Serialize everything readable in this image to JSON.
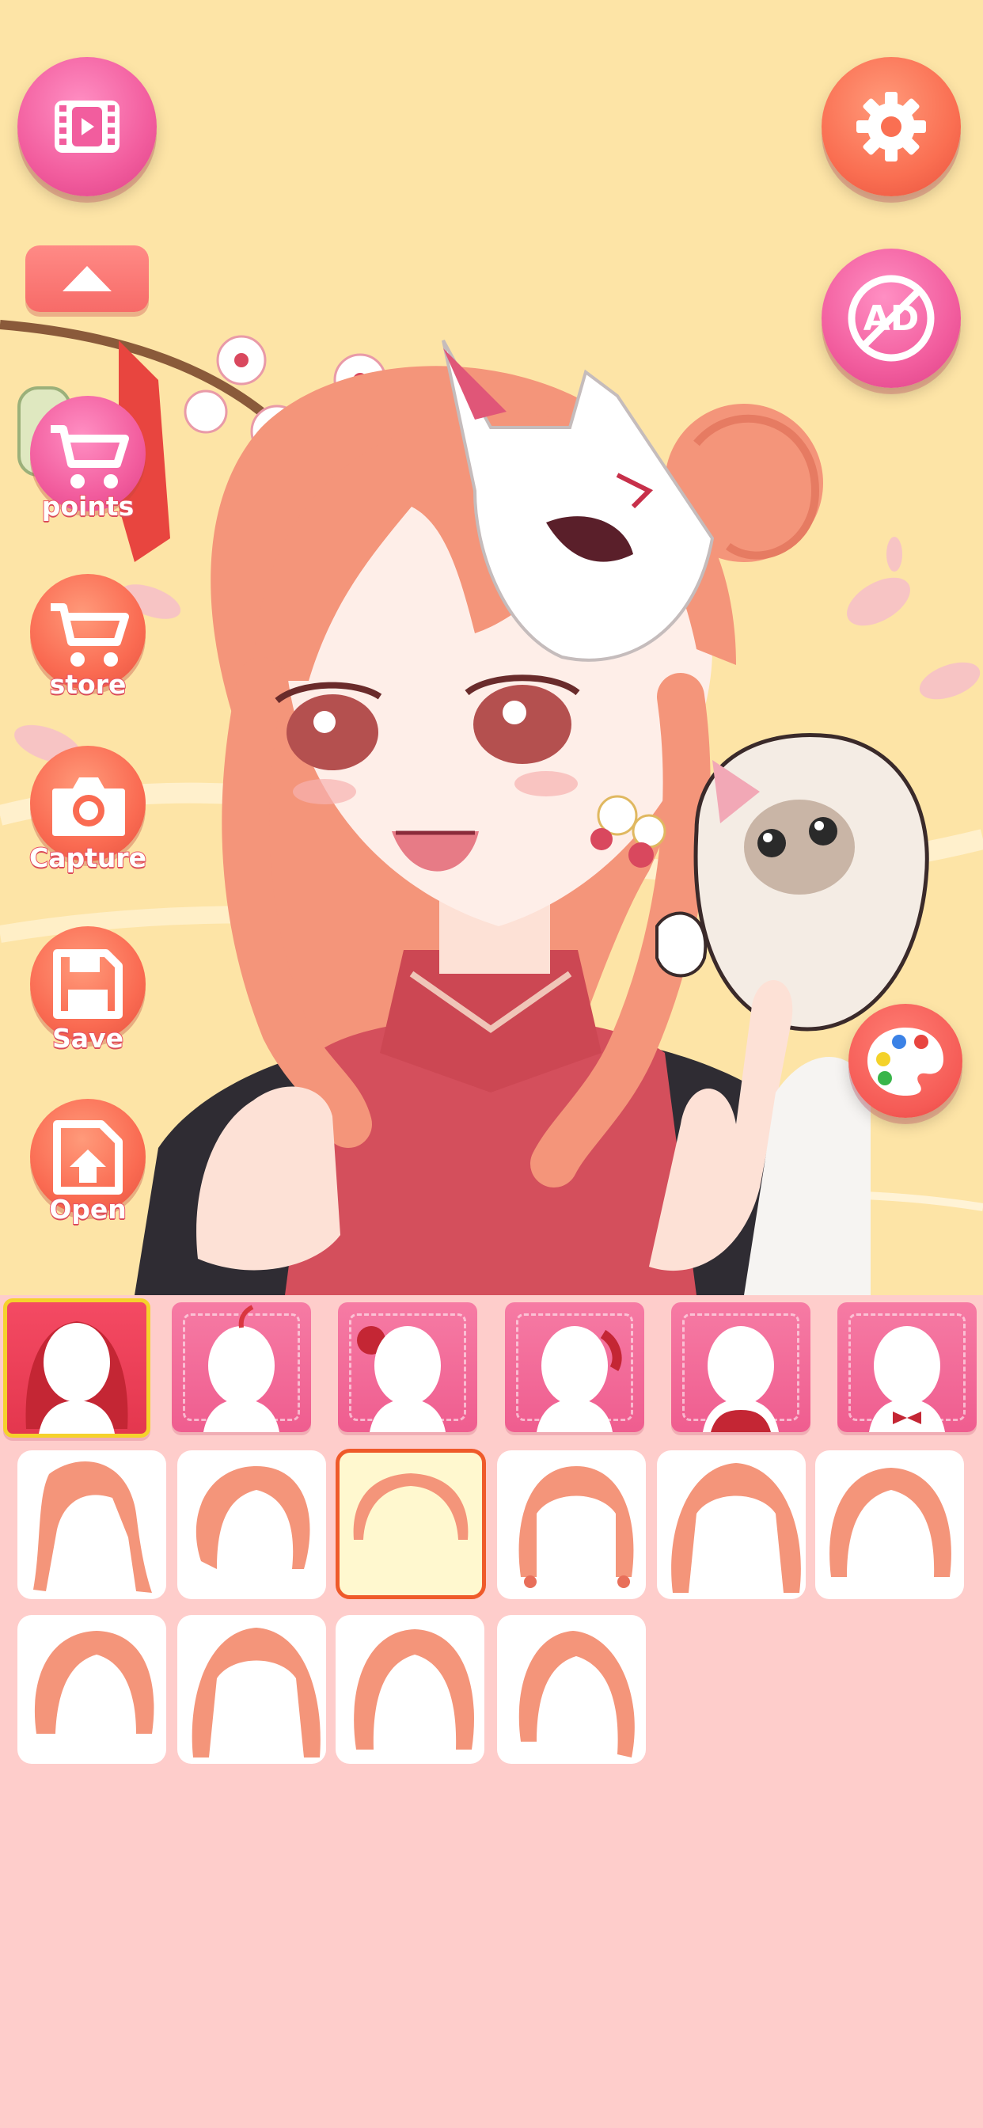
{
  "sidebar": {
    "points_label": "points",
    "store_label": "store",
    "capture_label": "Capture",
    "save_label": "Save",
    "open_label": "Open"
  },
  "icons": {
    "video": "video-icon",
    "settings": "gear-icon",
    "no_ads": "no-ads-icon",
    "collapse": "chevron-up-icon",
    "cart": "cart-icon",
    "camera": "camera-icon",
    "save": "floppy-icon",
    "open": "open-file-icon",
    "palette": "palette-icon"
  },
  "no_ads_text": "AD",
  "category_tabs": [
    {
      "name": "hair-back",
      "selected": true
    },
    {
      "name": "hair-front-ahoge",
      "selected": false
    },
    {
      "name": "hair-accessory",
      "selected": false
    },
    {
      "name": "hair-side",
      "selected": false
    },
    {
      "name": "top",
      "selected": false
    },
    {
      "name": "bow",
      "selected": false
    }
  ],
  "hair_options": [
    {
      "id": 1,
      "selected": false
    },
    {
      "id": 2,
      "selected": false
    },
    {
      "id": 3,
      "selected": true
    },
    {
      "id": 4,
      "selected": false
    },
    {
      "id": 5,
      "selected": false
    },
    {
      "id": 6,
      "selected": false
    },
    {
      "id": 7,
      "selected": false
    },
    {
      "id": 8,
      "selected": false
    },
    {
      "id": 9,
      "selected": false
    },
    {
      "id": 10,
      "selected": false
    }
  ],
  "colors": {
    "background": "#fde4a6",
    "panel": "#fecdcb",
    "accent_pink": "#f25d9e",
    "accent_orange": "#fa6f52",
    "hair": "#f4957a"
  }
}
